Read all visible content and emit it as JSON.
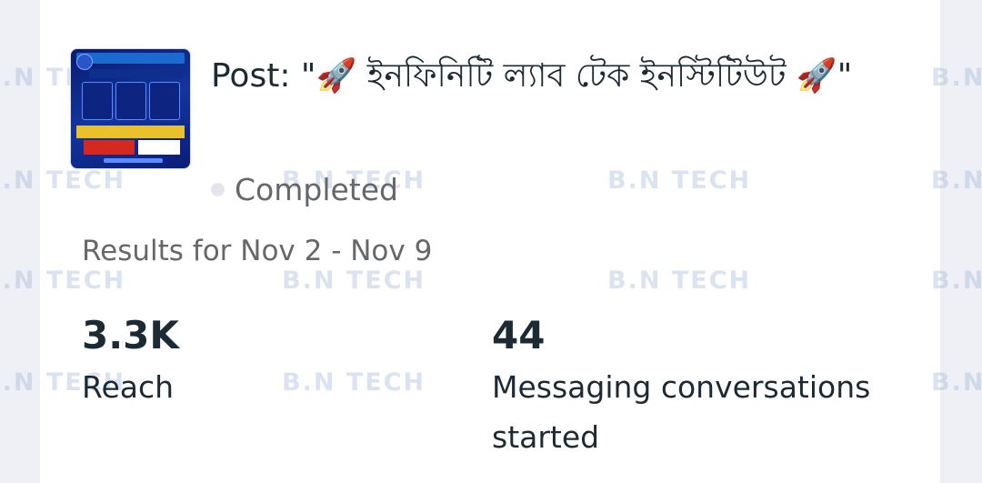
{
  "post": {
    "title": "Post: \"🚀 ইনফিনিটি ল্যাব টেক ইনস্টিটিউট 🚀\"",
    "thumbnail_icon": "post-image-icon",
    "status": "Completed"
  },
  "results_range": "Results for Nov 2 - Nov 9",
  "metrics": [
    {
      "value": "3.3K",
      "label": "Reach"
    },
    {
      "value": "44",
      "label": "Messaging conversations started"
    }
  ],
  "watermark": "B.N TECH",
  "colors": {
    "text": "#1c2b33",
    "muted": "#65676b",
    "status_dot": "#e4e6eb",
    "background": "#ffffff"
  }
}
